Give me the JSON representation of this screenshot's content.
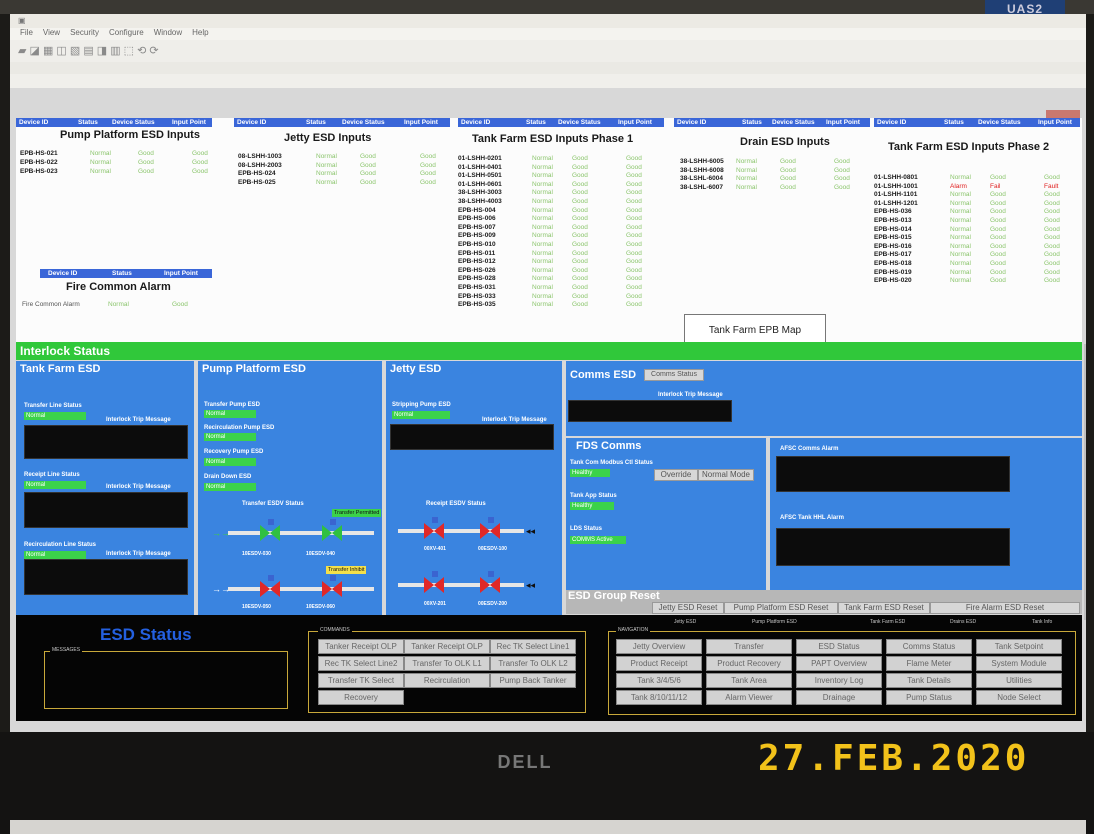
{
  "monitor": {
    "brand": "DELL",
    "photo_date": "27.FEB.2020",
    "usb_label": "UAS2"
  },
  "window": {
    "menu": [
      "File",
      "View",
      "Security",
      "Configure",
      "Window",
      "Help"
    ],
    "toolbar_icons": "▰ ◪ ▦ ◫ ▧ ▤ ◨ ▥ ⬚ ⟲ ⟳"
  },
  "top": {
    "hdr_cols": {
      "device_id": "Device ID",
      "status": "Status",
      "device_status": "Device Status",
      "input_point": "Input Point"
    },
    "pump_platform": {
      "title": "Pump Platform ESD Inputs",
      "rows": [
        [
          "EPB-HS-021",
          "Normal",
          "Good",
          "Good"
        ],
        [
          "EPB-HS-022",
          "Normal",
          "Good",
          "Good"
        ],
        [
          "EPB-HS-023",
          "Normal",
          "Good",
          "Good"
        ]
      ]
    },
    "fire_common": {
      "title": "Fire Common Alarm",
      "row": [
        "Fire Common Alarm",
        "Normal",
        "Good"
      ]
    },
    "jetty": {
      "title": "Jetty ESD Inputs",
      "rows": [
        [
          "08-LSHH-1003",
          "Normal",
          "Good",
          "Good"
        ],
        [
          "08-LSHH-2003",
          "Normal",
          "Good",
          "Good"
        ],
        [
          "EPB-HS-024",
          "Normal",
          "Good",
          "Good"
        ],
        [
          "EPB-HS-025",
          "Normal",
          "Good",
          "Good"
        ]
      ]
    },
    "tank_farm1": {
      "title": "Tank Farm ESD Inputs Phase 1",
      "rows": [
        [
          "01-LSHH-0201",
          "Normal",
          "Good",
          "Good"
        ],
        [
          "01-LSHH-0401",
          "Normal",
          "Good",
          "Good"
        ],
        [
          "01-LSHH-0501",
          "Normal",
          "Good",
          "Good"
        ],
        [
          "01-LSHH-0601",
          "Normal",
          "Good",
          "Good"
        ],
        [
          "38-LSHH-3003",
          "Normal",
          "Good",
          "Good"
        ],
        [
          "38-LSHH-4003",
          "Normal",
          "Good",
          "Good"
        ],
        [
          "EPB-HS-004",
          "Normal",
          "Good",
          "Good"
        ],
        [
          "EPB-HS-006",
          "Normal",
          "Good",
          "Good"
        ],
        [
          "EPB-HS-007",
          "Normal",
          "Good",
          "Good"
        ],
        [
          "EPB-HS-009",
          "Normal",
          "Good",
          "Good"
        ],
        [
          "EPB-HS-010",
          "Normal",
          "Good",
          "Good"
        ],
        [
          "EPB-HS-011",
          "Normal",
          "Good",
          "Good"
        ],
        [
          "EPB-HS-012",
          "Normal",
          "Good",
          "Good"
        ],
        [
          "EPB-HS-026",
          "Normal",
          "Good",
          "Good"
        ],
        [
          "EPB-HS-028",
          "Normal",
          "Good",
          "Good"
        ],
        [
          "EPB-HS-031",
          "Normal",
          "Good",
          "Good"
        ],
        [
          "EPB-HS-033",
          "Normal",
          "Good",
          "Good"
        ],
        [
          "EPB-HS-035",
          "Normal",
          "Good",
          "Good"
        ]
      ]
    },
    "drain": {
      "title": "Drain ESD Inputs",
      "rows": [
        [
          "38-LSHH-6005",
          "Normal",
          "Good",
          "Good"
        ],
        [
          "38-LSHH-6008",
          "Normal",
          "Good",
          "Good"
        ],
        [
          "38-LSHL-6004",
          "Normal",
          "Good",
          "Good"
        ],
        [
          "38-LSHL-6007",
          "Normal",
          "Good",
          "Good"
        ]
      ]
    },
    "tank_farm2": {
      "title": "Tank Farm ESD Inputs Phase 2",
      "rows": [
        [
          "01-LSHH-0801",
          "Normal",
          "Good",
          "Good"
        ],
        [
          "01-LSHH-1001",
          "Alarm",
          "Fail",
          "Fault"
        ],
        [
          "01-LSHH-1101",
          "Normal",
          "Good",
          "Good"
        ],
        [
          "01-LSHH-1201",
          "Normal",
          "Good",
          "Good"
        ],
        [
          "EPB-HS-036",
          "Normal",
          "Good",
          "Good"
        ],
        [
          "EPB-HS-013",
          "Normal",
          "Good",
          "Good"
        ],
        [
          "EPB-HS-014",
          "Normal",
          "Good",
          "Good"
        ],
        [
          "EPB-HS-015",
          "Normal",
          "Good",
          "Good"
        ],
        [
          "EPB-HS-016",
          "Normal",
          "Good",
          "Good"
        ],
        [
          "EPB-HS-017",
          "Normal",
          "Good",
          "Good"
        ],
        [
          "EPB-HS-018",
          "Normal",
          "Good",
          "Good"
        ],
        [
          "EPB-HS-019",
          "Normal",
          "Good",
          "Good"
        ],
        [
          "EPB-HS-020",
          "Normal",
          "Good",
          "Good"
        ]
      ]
    },
    "epb_map": "Tank Farm EPB Map"
  },
  "interlock": {
    "title": "Interlock Status",
    "tank_farm": {
      "title": "Tank Farm ESD",
      "items": [
        {
          "label": "Transfer Line Status",
          "value": "Normal"
        },
        {
          "label": "Receipt Line Status",
          "value": "Normal"
        },
        {
          "label": "Recirculation Line Status",
          "value": "Normal"
        }
      ],
      "trip_msg": "Interlock Trip Message"
    },
    "pump_platform": {
      "title": "Pump Platform ESD",
      "items": [
        {
          "label": "Transfer Pump ESD",
          "value": "Normal"
        },
        {
          "label": "Recirculation Pump ESD",
          "value": "Normal"
        },
        {
          "label": "Recovery Pump ESD",
          "value": "Normal"
        },
        {
          "label": "Drain Down ESD",
          "value": "Normal"
        }
      ],
      "esdv_title": "Transfer ESDV Status",
      "tag1": "Transfer Permitted",
      "tag2": "Transfer Inhibit",
      "v1": "10ESDV-030",
      "v2": "10ESDV-040",
      "v3": "10ESDV-050",
      "v4": "10ESDV-060"
    },
    "jetty": {
      "title": "Jetty ESD",
      "item": {
        "label": "Stripping Pump ESD",
        "value": "Normal"
      },
      "trip_msg": "Interlock Trip Message",
      "esdv_title": "Receipt ESDV Status",
      "v1": "00XV-401",
      "v2": "00ESDV-100",
      "v3": "00XV-201",
      "v4": "00ESDV-200"
    },
    "comms": {
      "title": "Comms ESD",
      "btn": "Comms Status",
      "trip_msg": "Interlock Trip Message"
    },
    "fds": {
      "title": "FDS Comms",
      "s1": "Tank Com Modbus Ctl Status",
      "v1": "Healthy",
      "override": "Override",
      "normal_mode": "Normal Mode",
      "s2": "Tank App Status",
      "v2": "Healthy",
      "s3": "LDS Status",
      "v3": "COMMS Active"
    },
    "afsc": {
      "a1": "AFSC Comms Alarm",
      "a2": "AFSC Tank HHL Alarm"
    },
    "group_reset": {
      "title": "ESD Group Reset",
      "buttons": [
        "Jetty ESD Reset",
        "Pump Platform ESD Reset",
        "Tank Farm ESD Reset",
        "Fire Alarm ESD Reset"
      ]
    }
  },
  "bottom": {
    "esd_status": "ESD Status",
    "messages": "MESSAGES",
    "commands_label": "COMMANDS",
    "commands": [
      "Tanker Receipt OLP",
      "Tanker Receipt OLP",
      "Rec TK Select Line1",
      "Rec TK Select Line2",
      "Transfer To OLK L1",
      "Transfer To OLK L2",
      "Transfer TK Select",
      "Recirculation",
      "Pump Back Tanker",
      "Recovery"
    ],
    "nav_label": "NAVIGATION",
    "nav_headers": [
      "Jetty ESD",
      "Pump Platform ESD",
      "Tank Farm ESD",
      "Drains ESD",
      "Tank Info"
    ],
    "nav": [
      "Jetty Overview",
      "Transfer",
      "ESD Status",
      "Comms Status",
      "Tank Setpoint",
      "Product Receipt",
      "Product Recovery",
      "PAPT Overview",
      "Flame Meter",
      "System Module",
      "Tank 3/4/5/6",
      "Tank Area",
      "Inventory Log",
      "Tank Details",
      "Utilities",
      "Tank 8/10/11/12",
      "Alarm Viewer",
      "Drainage",
      "Pump Status",
      "Node Select"
    ]
  }
}
